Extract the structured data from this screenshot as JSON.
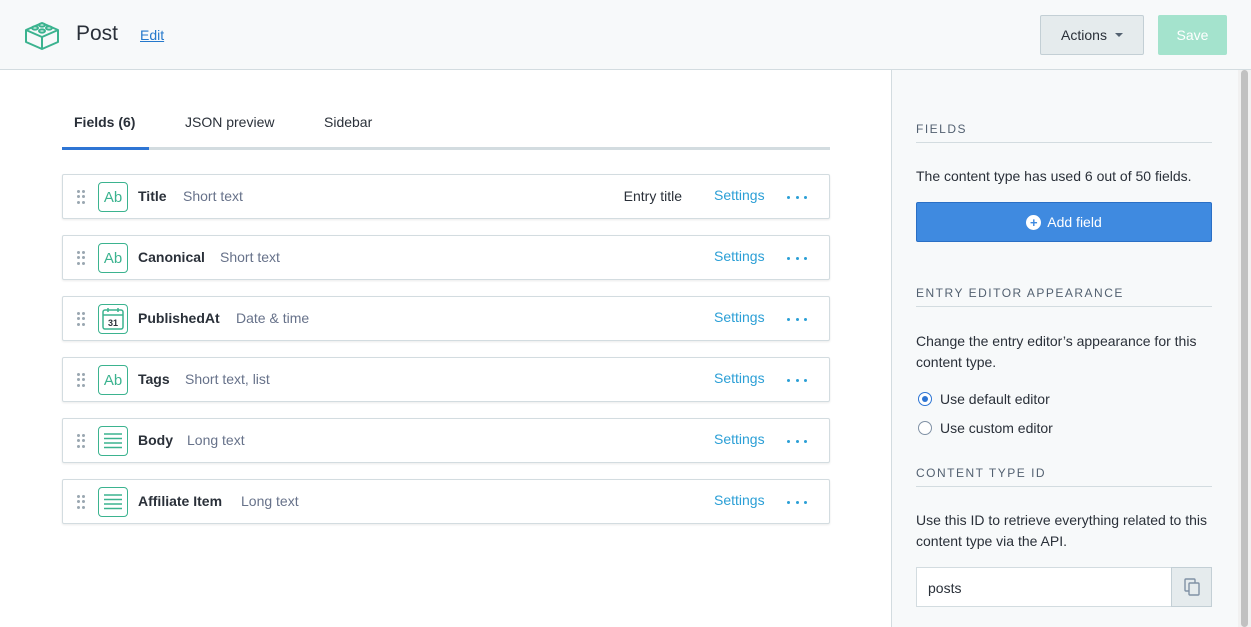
{
  "header": {
    "logo_icon": "content-type-blocks-icon",
    "title": "Post",
    "edit_label": "Edit",
    "actions_label": "Actions",
    "save_label": "Save"
  },
  "tabs": [
    {
      "label": "Fields (6)",
      "active": true
    },
    {
      "label": "JSON preview",
      "active": false
    },
    {
      "label": "Sidebar",
      "active": false
    }
  ],
  "fields": [
    {
      "name": "Title",
      "type": "Short text",
      "icon": "short-text-icon",
      "badge": "Entry title",
      "settings": "Settings"
    },
    {
      "name": "Canonical",
      "type": "Short text",
      "icon": "short-text-icon",
      "badge": "",
      "settings": "Settings"
    },
    {
      "name": "PublishedAt",
      "type": "Date & time",
      "icon": "calendar-icon",
      "badge": "",
      "settings": "Settings"
    },
    {
      "name": "Tags",
      "type": "Short text, list",
      "icon": "short-text-icon",
      "badge": "",
      "settings": "Settings"
    },
    {
      "name": "Body",
      "type": "Long text",
      "icon": "long-text-icon",
      "badge": "",
      "settings": "Settings"
    },
    {
      "name": "Affiliate Item",
      "type": "Long text",
      "icon": "long-text-icon",
      "badge": "",
      "settings": "Settings"
    }
  ],
  "icon_text": {
    "short_text": "Ab",
    "calendar": "31"
  },
  "sidebar": {
    "fields_heading": "Fields",
    "fields_usage": "The content type has used 6 out of 50 fields.",
    "add_field_label": "Add field",
    "editor_heading": "Entry editor appearance",
    "editor_desc": "Change the entry editor’s appearance for this content type.",
    "default_editor_label": "Use default editor",
    "custom_editor_label": "Use custom editor",
    "selected_editor": "default",
    "id_heading": "Content type ID",
    "id_desc": "Use this ID to retrieve everything related to this content type via the API.",
    "id_value": "posts"
  },
  "colors": {
    "accent_green": "#3bb38f",
    "link_blue": "#2b9fd6",
    "primary_blue": "#3f8ae0",
    "save_disabled": "#a4e3cd"
  }
}
